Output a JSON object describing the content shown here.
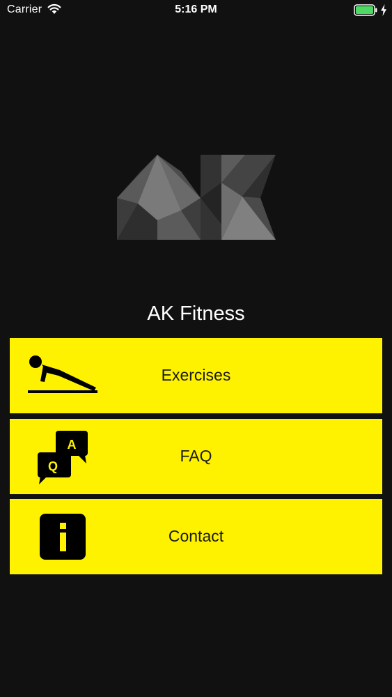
{
  "status_bar": {
    "carrier": "Carrier",
    "time": "5:16 PM",
    "icons": [
      "wifi-icon",
      "battery-icon",
      "charging-bolt-icon"
    ]
  },
  "app": {
    "title": "AK Fitness",
    "logo_icon": "ak-logo-icon"
  },
  "menu": {
    "items": [
      {
        "label": "Exercises",
        "icon": "pushup-icon"
      },
      {
        "label": "FAQ",
        "icon": "qa-chat-icon",
        "icon_letters": [
          "A",
          "Q"
        ]
      },
      {
        "label": "Contact",
        "icon": "info-icon"
      }
    ]
  },
  "colors": {
    "background": "#111112",
    "menu_background": "#fff200",
    "menu_text": "#1a1a1a",
    "icon": "#000000",
    "title": "#ffffff"
  }
}
